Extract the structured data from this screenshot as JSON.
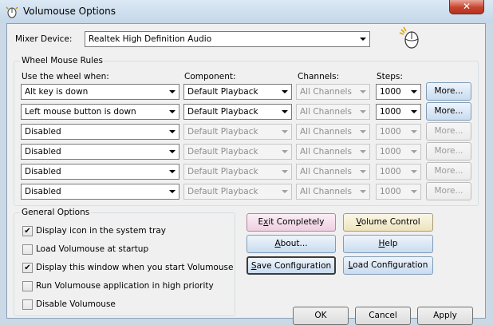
{
  "window": {
    "title": "Volumouse Options",
    "close_glyph": "✕",
    "app_icon": "volumouse-app-icon",
    "mouse_icon": "mouse-icon"
  },
  "mixer": {
    "label": "Mixer Device:",
    "value": "Realtek High Definition Audio"
  },
  "rules": {
    "title": "Wheel Mouse Rules",
    "headers": {
      "use_wheel": "Use the wheel when:",
      "component": "Component:",
      "channels": "Channels:",
      "steps": "Steps:"
    },
    "rows": [
      {
        "when": "Alt key is down",
        "component": "Default Playback",
        "channels": "All Channels",
        "steps": "1000",
        "more": "More...",
        "enabled": true
      },
      {
        "when": "Left mouse button is down",
        "component": "Default Playback",
        "channels": "All Channels",
        "steps": "1000",
        "more": "More...",
        "enabled": true
      },
      {
        "when": "Disabled",
        "component": "Default Playback",
        "channels": "All Channels",
        "steps": "1000",
        "more": "More...",
        "enabled": false
      },
      {
        "when": "Disabled",
        "component": "Default Playback",
        "channels": "All Channels",
        "steps": "1000",
        "more": "More...",
        "enabled": false
      },
      {
        "when": "Disabled",
        "component": "Default Playback",
        "channels": "All Channels",
        "steps": "1000",
        "more": "More...",
        "enabled": false
      },
      {
        "when": "Disabled",
        "component": "Default Playback",
        "channels": "All Channels",
        "steps": "1000",
        "more": "More...",
        "enabled": false
      }
    ]
  },
  "general": {
    "title": "General Options",
    "options": [
      {
        "label": "Display icon in the system tray",
        "checked": true
      },
      {
        "label": "Load Volumouse at startup",
        "checked": false
      },
      {
        "label": "Display this window when you start Volumouse",
        "checked": true
      },
      {
        "label": "Run Volumouse application in high priority",
        "checked": false
      },
      {
        "label": "Disable Volumouse",
        "checked": false
      }
    ]
  },
  "actions": {
    "exit_pre": "E",
    "exit_key": "x",
    "exit_post": "it Completely",
    "volume_key": "V",
    "volume_post": "olume Control",
    "about_pre": "",
    "about_key": "A",
    "about_post": "bout...",
    "help_key": "H",
    "help_post": "elp",
    "save_key": "S",
    "save_post": "ave Configuration",
    "load_key": "L",
    "load_post": "oad Configuration"
  },
  "footer": {
    "ok": "OK",
    "cancel": "Cancel",
    "apply": "Apply"
  },
  "colors": {
    "exit_button": "#efcfe1",
    "volume_button": "#eee3bd",
    "blue_button": "#c9dcf0",
    "titlebar": "#c4d6e8"
  }
}
